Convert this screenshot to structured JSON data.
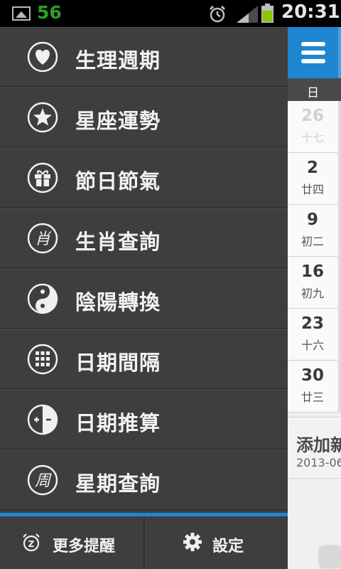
{
  "status_bar": {
    "notification_count": "56",
    "time": "20:31"
  },
  "menu": {
    "items": [
      {
        "label": "生理週期",
        "icon": "heart-icon"
      },
      {
        "label": "星座運勢",
        "icon": "star-icon"
      },
      {
        "label": "節日節氣",
        "icon": "gift-icon"
      },
      {
        "label": "生肖查詢",
        "icon": "zodiac-icon"
      },
      {
        "label": "陰陽轉換",
        "icon": "yin-yang-icon"
      },
      {
        "label": "日期間隔",
        "icon": "grid-icon"
      },
      {
        "label": "日期推算",
        "icon": "plus-minus-icon"
      },
      {
        "label": "星期查詢",
        "icon": "week-icon"
      }
    ],
    "zodiac_glyph": "肖",
    "week_glyph": "周",
    "more_reminders": "更多提醒",
    "settings": "設定"
  },
  "calendar": {
    "day_header": "日",
    "days": [
      {
        "day": "26",
        "lunar": "十七",
        "dim": true
      },
      {
        "day": "2",
        "lunar": "廿四",
        "dim": false
      },
      {
        "day": "9",
        "lunar": "初二",
        "dim": false
      },
      {
        "day": "16",
        "lunar": "初九",
        "dim": false
      },
      {
        "day": "23",
        "lunar": "十六",
        "dim": false
      },
      {
        "day": "30",
        "lunar": "廿三",
        "dim": false
      }
    ],
    "add_title": "添加新",
    "add_date": "2013-06"
  },
  "colors": {
    "accent": "#1f86d1",
    "drawer_bg": "#3e3e3e",
    "calendar_bg": "#f0f0f0"
  }
}
